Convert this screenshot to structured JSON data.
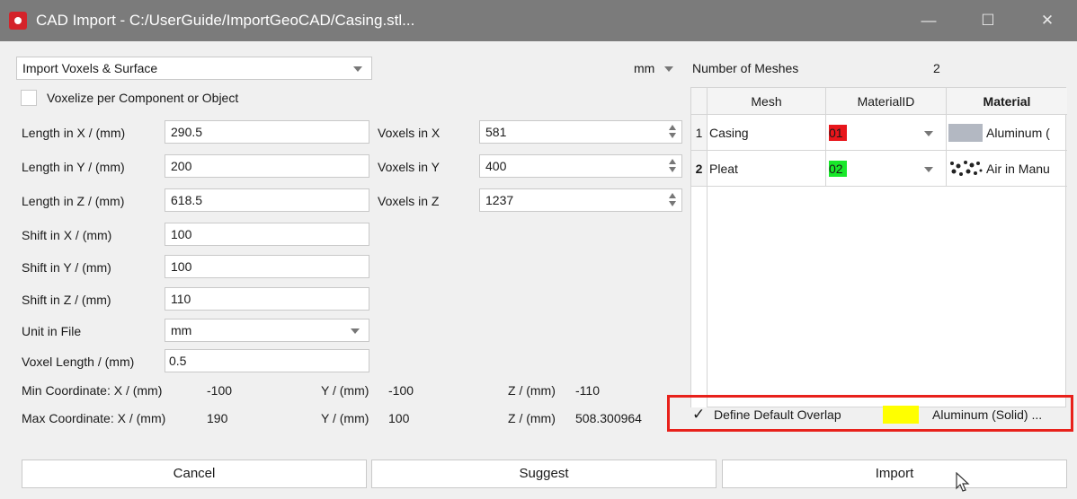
{
  "window": {
    "title": "CAD Import - C:/UserGuide/ImportGeoCAD/Casing.stl...",
    "minimize": "—",
    "maximize": "☐",
    "close": "✕"
  },
  "import_mode": {
    "value": "Import Voxels & Surface"
  },
  "unit_combo": {
    "value": "mm"
  },
  "voxelize_checkbox": {
    "label": "Voxelize per Component or Object",
    "checked": false
  },
  "lengths": [
    {
      "label": "Length in X / (mm)",
      "value": "290.5",
      "voxels_label": "Voxels in X",
      "voxels_value": "581"
    },
    {
      "label": "Length in Y / (mm)",
      "value": "200",
      "voxels_label": "Voxels in Y",
      "voxels_value": "400"
    },
    {
      "label": "Length in Z / (mm)",
      "value": "618.5",
      "voxels_label": "Voxels in Z",
      "voxels_value": "1237"
    }
  ],
  "shifts": [
    {
      "label": "Shift  in X / (mm)",
      "value": "100"
    },
    {
      "label": "Shift  in Y / (mm)",
      "value": "100"
    },
    {
      "label": "Shift  in Z / (mm)",
      "value": "110"
    }
  ],
  "unit_in_file": {
    "label": "Unit in File",
    "value": "mm"
  },
  "voxel_length": {
    "label": "Voxel Length / (mm)",
    "value": "0.5"
  },
  "min_coord": {
    "x_label": "Min Coordinate: X / (mm)",
    "x": "-100",
    "y_label": "Y / (mm)",
    "y": "-100",
    "z_label": "Z / (mm)",
    "z": "-110"
  },
  "max_coord": {
    "x_label": "Max Coordinate: X / (mm)",
    "x": "190",
    "y_label": "Y / (mm)",
    "y": "100",
    "z_label": "Z / (mm)",
    "z": "508.300964"
  },
  "meshes": {
    "count_label": "Number of Meshes",
    "count": "2",
    "columns": [
      "Mesh",
      "MaterialID",
      "Material"
    ],
    "rows": [
      {
        "index": "1",
        "mesh": "Casing",
        "material_id": "01",
        "id_color": "#e8161b",
        "material": "Aluminum (",
        "swatch_color": "#b3b8c2"
      },
      {
        "index": "2",
        "mesh": "Pleat",
        "material_id": "02",
        "id_color": "#18e82a",
        "material": "Air in Manu",
        "swatch_color": "#ffffff"
      }
    ]
  },
  "default_overlap": {
    "checkmark": "✓",
    "label": "Define Default Overlap",
    "material": "Aluminum (Solid) ...",
    "color": "#ffff00",
    "highlight_color": "#e8211b"
  },
  "buttons": {
    "cancel": "Cancel",
    "suggest": "Suggest",
    "import": "Import"
  }
}
